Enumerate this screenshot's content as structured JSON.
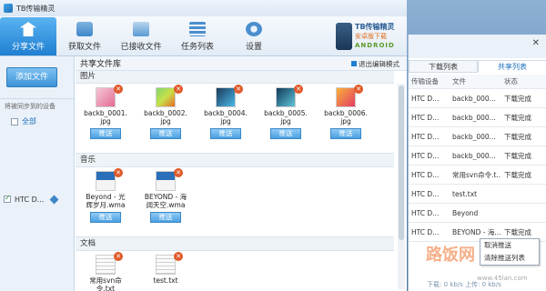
{
  "window": {
    "title": "TB传输精灵"
  },
  "toolbar": {
    "items": [
      {
        "label": "分享文件",
        "icon": "share-icon",
        "active": true
      },
      {
        "label": "获取文件",
        "icon": "download-icon"
      },
      {
        "label": "已接收文件",
        "icon": "inbox-icon"
      },
      {
        "label": "任务列表",
        "icon": "list-icon"
      },
      {
        "label": "设置",
        "icon": "gear-icon"
      }
    ],
    "brand": {
      "line1": "TB传输精灵",
      "line2": "安卓版下载",
      "line3": "ANDROID"
    }
  },
  "sidebar": {
    "add_file": "添加文件",
    "synced_label": "将被同步到的设备",
    "all_label": "全部",
    "device": "HTC D..."
  },
  "library": {
    "title": "共享文件库",
    "exit_edit": "退出编辑模式",
    "images_header": "图片",
    "images": [
      {
        "name": "backb_0001.\njpg"
      },
      {
        "name": "backb_0002.\njpg"
      },
      {
        "name": "backb_0004.\njpg"
      },
      {
        "name": "backb_0005.\njpg"
      },
      {
        "name": "backb_0006.\njpg"
      }
    ],
    "music_header": "音乐",
    "music": [
      {
        "name": "Beyond - 光\n辉岁月.wma"
      },
      {
        "name": "BEYOND - 海\n阔天空.wma"
      }
    ],
    "docs_header": "文档",
    "docs": [
      {
        "name": "常用svn命\n令.txt"
      },
      {
        "name": "test.txt"
      }
    ],
    "push_label": "推送"
  },
  "right_panel": {
    "close_icon": "✕",
    "tabs": [
      {
        "label": "下载列表"
      },
      {
        "label": "共享列表",
        "active": true
      }
    ],
    "columns": [
      "传输设备",
      "文件",
      "状态"
    ],
    "rows": [
      {
        "device": "HTC D...",
        "file": "backb_000...",
        "status": "下载完成"
      },
      {
        "device": "HTC D...",
        "file": "backb_000...",
        "status": "下载完成"
      },
      {
        "device": "HTC D...",
        "file": "backb_000...",
        "status": "下载完成"
      },
      {
        "device": "HTC D...",
        "file": "backb_000...",
        "status": "下载完成"
      },
      {
        "device": "HTC D...",
        "file": "常用svn命令.t...",
        "status": "下载完成"
      },
      {
        "device": "HTC D...",
        "file": "test.txt",
        "status": ""
      },
      {
        "device": "HTC D...",
        "file": "Beyond",
        "status": ""
      },
      {
        "device": "HTC D...",
        "file": "BEYOND - 海...",
        "status": "下载完成"
      }
    ],
    "context_menu": [
      "取消推送",
      "清除推送列表"
    ],
    "status_bar": "下载: 0 kb/s    上传: 0 kb/s"
  },
  "watermark": {
    "text": "路饭网",
    "url": "www.45lan.com"
  }
}
